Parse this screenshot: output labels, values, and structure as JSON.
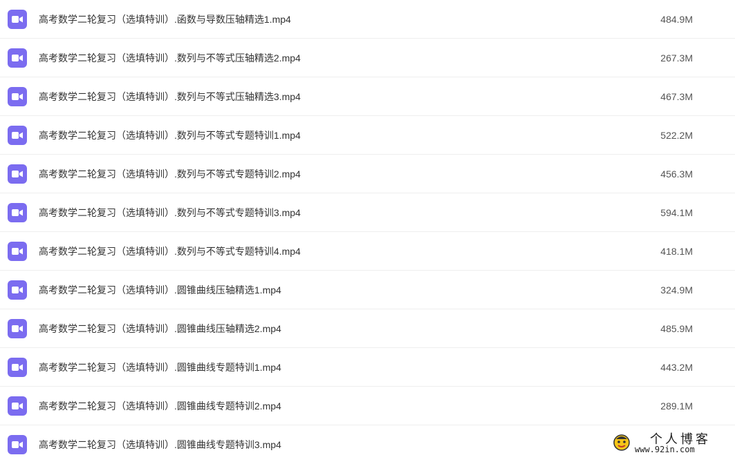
{
  "files": [
    {
      "name": "高考数学二轮复习（选填特训）.函数与导数压轴精选1.mp4",
      "size": "484.9M",
      "icon": "video-file-icon"
    },
    {
      "name": "高考数学二轮复习（选填特训）.数列与不等式压轴精选2.mp4",
      "size": "267.3M",
      "icon": "video-file-icon"
    },
    {
      "name": "高考数学二轮复习（选填特训）.数列与不等式压轴精选3.mp4",
      "size": "467.3M",
      "icon": "video-file-icon"
    },
    {
      "name": "高考数学二轮复习（选填特训）.数列与不等式专题特训1.mp4",
      "size": "522.2M",
      "icon": "video-file-icon"
    },
    {
      "name": "高考数学二轮复习（选填特训）.数列与不等式专题特训2.mp4",
      "size": "456.3M",
      "icon": "video-file-icon"
    },
    {
      "name": "高考数学二轮复习（选填特训）.数列与不等式专题特训3.mp4",
      "size": "594.1M",
      "icon": "video-file-icon"
    },
    {
      "name": "高考数学二轮复习（选填特训）.数列与不等式专题特训4.mp4",
      "size": "418.1M",
      "icon": "video-file-icon"
    },
    {
      "name": "高考数学二轮复习（选填特训）.圆锥曲线压轴精选1.mp4",
      "size": "324.9M",
      "icon": "video-file-icon"
    },
    {
      "name": "高考数学二轮复习（选填特训）.圆锥曲线压轴精选2.mp4",
      "size": "485.9M",
      "icon": "video-file-icon"
    },
    {
      "name": "高考数学二轮复习（选填特训）.圆锥曲线专题特训1.mp4",
      "size": "443.2M",
      "icon": "video-file-icon"
    },
    {
      "name": "高考数学二轮复习（选填特训）.圆锥曲线专题特训2.mp4",
      "size": "289.1M",
      "icon": "video-file-icon"
    },
    {
      "name": "高考数学二轮复习（选填特训）.圆锥曲线专题特训3.mp4",
      "size": "",
      "icon": "video-file-icon"
    }
  ],
  "watermark": {
    "title": "个人博客",
    "url": "www.92in.com"
  },
  "colors": {
    "icon_bg": "#7b6cf0",
    "divider": "#eeeeee",
    "text": "#333333"
  }
}
